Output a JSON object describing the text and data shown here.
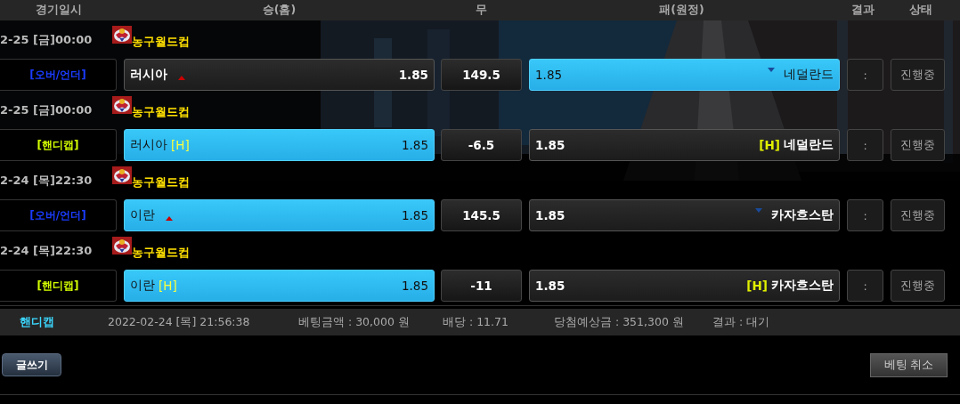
{
  "header": {
    "columns": [
      "경기일시",
      "승(홈)",
      "무",
      "패(원정)",
      "결과",
      "상태"
    ]
  },
  "games": [
    {
      "date": "2-25 [금]00:00",
      "league": "농구월드컵",
      "kind": "over_under",
      "type_label": "[오버/언더]",
      "home": {
        "name": "러시아",
        "odds": "1.85",
        "selected": false
      },
      "draw": "149.5",
      "away": {
        "name": "네덜란드",
        "odds": "1.85",
        "selected": true
      },
      "result": ":",
      "status": "진행중"
    },
    {
      "date": "2-25 [금]00:00",
      "league": "농구월드컵",
      "kind": "handicap",
      "type_label": "[핸디캡]",
      "home": {
        "name": "러시아",
        "tag": "[H]",
        "odds": "1.85",
        "selected": true
      },
      "draw": "-6.5",
      "away": {
        "name": "네덜란드",
        "tag": "[H]",
        "odds": "1.85",
        "selected": false
      },
      "result": ":",
      "status": "진행중"
    },
    {
      "date": "2-24 [목]22:30",
      "league": "농구월드컵",
      "kind": "over_under",
      "type_label": "[오버/언더]",
      "home": {
        "name": "이란",
        "odds": "1.85",
        "selected": true
      },
      "draw": "145.5",
      "away": {
        "name": "카자흐스탄",
        "odds": "1.85",
        "selected": false
      },
      "result": ":",
      "status": "진행중"
    },
    {
      "date": "2-24 [목]22:30",
      "league": "농구월드컵",
      "kind": "handicap",
      "type_label": "[핸디캡]",
      "home": {
        "name": "이란",
        "tag": "[H]",
        "odds": "1.85",
        "selected": true
      },
      "draw": "-11",
      "away": {
        "name": "카자흐스탄",
        "tag": "[H]",
        "odds": "1.85",
        "selected": false
      },
      "result": ":",
      "status": "진행중"
    }
  ],
  "summary": {
    "type": "핸디캡",
    "datetime": "2022-02-24 [목] 21:56:38",
    "amount": "베팅금액 : 30,000 원",
    "odds": "배당 : 11.71",
    "expected": "당첨예상금 : 351,300 원",
    "result": "결과 : 대기"
  },
  "buttons": {
    "write": "글쓰기",
    "cancel": "베팅 취소"
  }
}
